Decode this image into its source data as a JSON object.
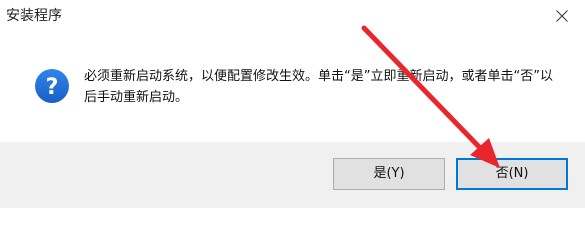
{
  "window": {
    "title": "安装程序",
    "close_icon": "close-icon"
  },
  "message": {
    "icon": "question-icon",
    "icon_color": "#1e6fd9",
    "text": "必须重新启动系统，以便配置修改生效。单击“是”立即重新启动，或者单击“否”以后手动重新启动。"
  },
  "buttons": {
    "yes_label": "是(Y)",
    "no_label": "否(N)"
  },
  "annotation": {
    "arrow_color": "#e8262b"
  }
}
